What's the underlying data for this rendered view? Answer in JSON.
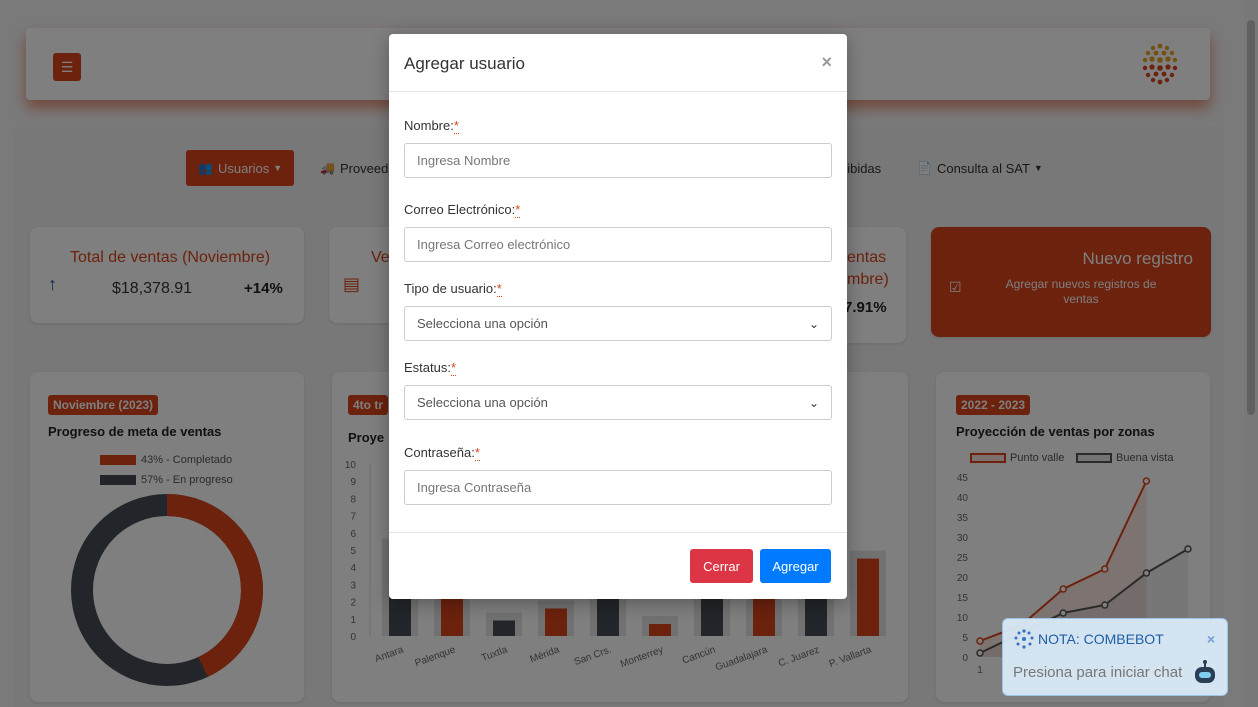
{
  "nav": {
    "items": [
      {
        "label": "Usuarios",
        "icon": "users-icon",
        "active": true
      },
      {
        "label": "Proveedores",
        "icon": "truck-icon",
        "active": false
      },
      {
        "label": "Facturas recibidas",
        "icon": "file-icon",
        "active": false
      },
      {
        "label": "Consulta al SAT",
        "icon": "file-icon",
        "active": false
      }
    ]
  },
  "cards": {
    "total_sales": {
      "title": "Total de ventas (Noviembre)",
      "value": "$18,378.91",
      "pct": "+14%"
    },
    "card2": {
      "title": "Ve"
    },
    "card3": {
      "title1": "entas",
      "title2": "mbre)",
      "value": "7.91%"
    },
    "new_record": {
      "title": "Nuevo registro",
      "subtitle": "Agregar nuevos registros de ventas"
    }
  },
  "panels": {
    "goal": {
      "badge": "Noviembre (2023)",
      "title": "Progreso de meta de ventas",
      "legend": [
        "43% - Completado",
        "57% - En progreso"
      ]
    },
    "quarter": {
      "badge": "4to tr",
      "title": "Proye",
      "y_ticks": [
        "10",
        "9",
        "8",
        "7",
        "6",
        "5",
        "4",
        "3",
        "2",
        "1",
        "0"
      ],
      "categories": [
        "Antara",
        "Palenque",
        "Tuxtla",
        "Mérida",
        "San Crs.",
        "Monterrey",
        "Cancún",
        "Guadalajara",
        "C. Juarez",
        "P. Vallarta"
      ]
    },
    "zones": {
      "badge": "2022 - 2023",
      "title": "Proyección de ventas por zonas",
      "legend": [
        "Punto valle",
        "Buena vista"
      ],
      "y_ticks": [
        "45",
        "40",
        "35",
        "30",
        "25",
        "20",
        "15",
        "10",
        "5",
        "0"
      ],
      "x_tick": "1"
    }
  },
  "chart_data": [
    {
      "type": "pie",
      "labels": [
        "43% - Completado",
        "57% - En progreso"
      ],
      "values": [
        43,
        57
      ]
    },
    {
      "type": "bar",
      "categories": [
        "Antara",
        "Palenque",
        "Tuxtla",
        "Mérida",
        "San Crs.",
        "Monterrey",
        "Cancún",
        "Guadalajara",
        "C. Juarez",
        "P. Vallarta"
      ],
      "values": [
        5.2,
        5.3,
        0.9,
        1.6,
        5.2,
        0.7,
        5.2,
        5.2,
        5.2,
        4.5
      ],
      "ylim": [
        0,
        10
      ]
    },
    {
      "type": "line",
      "x": [
        1,
        2,
        3,
        4,
        5,
        6
      ],
      "series": [
        {
          "name": "Punto valle",
          "values": [
            4,
            8,
            17,
            22,
            44,
            null
          ]
        },
        {
          "name": "Buena vista",
          "values": [
            1,
            6,
            11,
            13,
            21,
            27
          ]
        }
      ],
      "ylim": [
        0,
        45
      ]
    }
  ],
  "modal": {
    "title": "Agregar usuario",
    "close_symbol": "×",
    "fields": {
      "name": {
        "label": "Nombre:",
        "placeholder": "Ingresa Nombre"
      },
      "email": {
        "label": "Correo Electrónico:",
        "placeholder": "Ingresa Correo electrónico"
      },
      "type": {
        "label": "Tipo de usuario:",
        "value": "Selecciona una opción"
      },
      "status": {
        "label": "Estatus:",
        "value": "Selecciona una opción"
      },
      "password": {
        "label": "Contraseña:",
        "placeholder": "Ingresa Contraseña"
      }
    },
    "required_mark": "*",
    "buttons": {
      "close": "Cerrar",
      "add": "Agregar"
    }
  },
  "chat": {
    "title": "NOTA: COMBEBOT",
    "subtitle": "Presiona para iniciar chat",
    "close_symbol": "×"
  },
  "colors": {
    "accent": "#d8451a",
    "dark": "#444b52",
    "danger": "#dc3545",
    "primary": "#007bff"
  }
}
